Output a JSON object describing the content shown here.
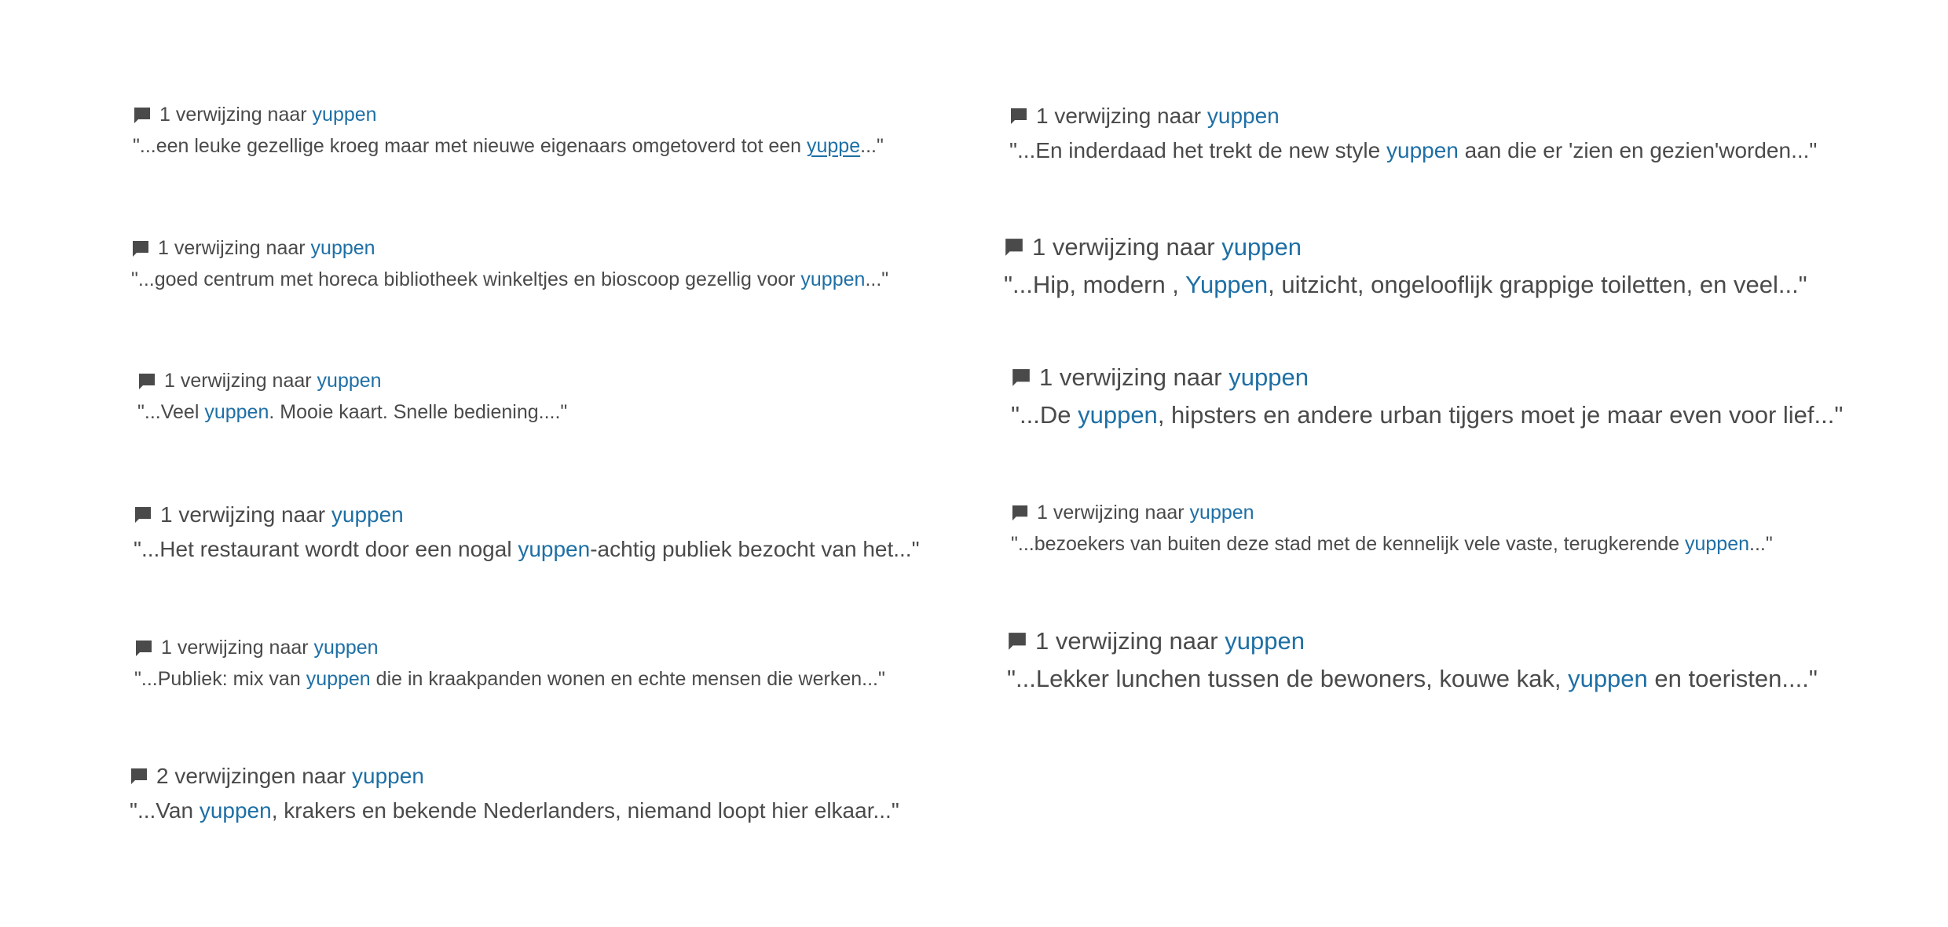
{
  "colors": {
    "text": "#4a4a4a",
    "highlight": "#1e6fa5",
    "icon": "#4a4a4a",
    "background": "#ffffff"
  },
  "icons": {
    "reference": "comment-bubble-icon"
  },
  "entries": [
    {
      "count_text": "1 verwijzing naar",
      "keyword": "yuppen",
      "snippet_before": "\"...een leuke gezellige kroeg maar met nieuwe eigenaars omgetoverd tot een ",
      "snippet_keyword": "yuppe",
      "snippet_after": "...\""
    },
    {
      "count_text": "1 verwijzing naar",
      "keyword": "yuppen",
      "snippet_before": "\"...goed centrum met horeca bibliotheek winkeltjes en bioscoop gezellig voor ",
      "snippet_keyword": "yuppen",
      "snippet_after": "...\""
    },
    {
      "count_text": "1 verwijzing naar",
      "keyword": "yuppen",
      "snippet_before": "\"...Veel ",
      "snippet_keyword": "yuppen",
      "snippet_after": ". Mooie kaart. Snelle bediening....\""
    },
    {
      "count_text": "1 verwijzing naar",
      "keyword": "yuppen",
      "snippet_before": "\"...Het restaurant wordt door een nogal ",
      "snippet_keyword": "yuppen",
      "snippet_after": "-achtig publiek bezocht van het...\""
    },
    {
      "count_text": "1 verwijzing naar",
      "keyword": "yuppen",
      "snippet_before": "\"...Publiek: mix van ",
      "snippet_keyword": "yuppen",
      "snippet_after": " die in kraakpanden wonen en echte mensen die werken...\""
    },
    {
      "count_text": "2 verwijzingen naar",
      "keyword": "yuppen",
      "snippet_before": "\"...Van ",
      "snippet_keyword": "yuppen",
      "snippet_after": ", krakers en bekende Nederlanders, niemand loopt hier elkaar...\""
    },
    {
      "count_text": "1 verwijzing naar",
      "keyword": "yuppen",
      "snippet_before": "\"...En inderdaad het trekt de new style ",
      "snippet_keyword": "yuppen",
      "snippet_after": " aan die er 'zien en gezien'worden...\""
    },
    {
      "count_text": "1 verwijzing naar",
      "keyword": "yuppen",
      "snippet_before": "\"...Hip, modern , ",
      "snippet_keyword": "Yuppen",
      "snippet_after": ", uitzicht, ongelooflijk grappige toiletten, en veel...\""
    },
    {
      "count_text": "1 verwijzing naar",
      "keyword": "yuppen",
      "snippet_before": "\"...De ",
      "snippet_keyword": "yuppen",
      "snippet_after": ", hipsters en andere urban tijgers moet je maar even voor lief...\""
    },
    {
      "count_text": "1 verwijzing naar",
      "keyword": "yuppen",
      "snippet_before": "\"...bezoekers van buiten deze stad met de kennelijk vele vaste, terugkerende ",
      "snippet_keyword": "yuppen",
      "snippet_after": "...\""
    },
    {
      "count_text": "1 verwijzing naar",
      "keyword": "yuppen",
      "snippet_before": "\"...Lekker lunchen tussen de bewoners, kouwe kak, ",
      "snippet_keyword": "yuppen",
      "snippet_after": " en toeristen....\""
    }
  ]
}
